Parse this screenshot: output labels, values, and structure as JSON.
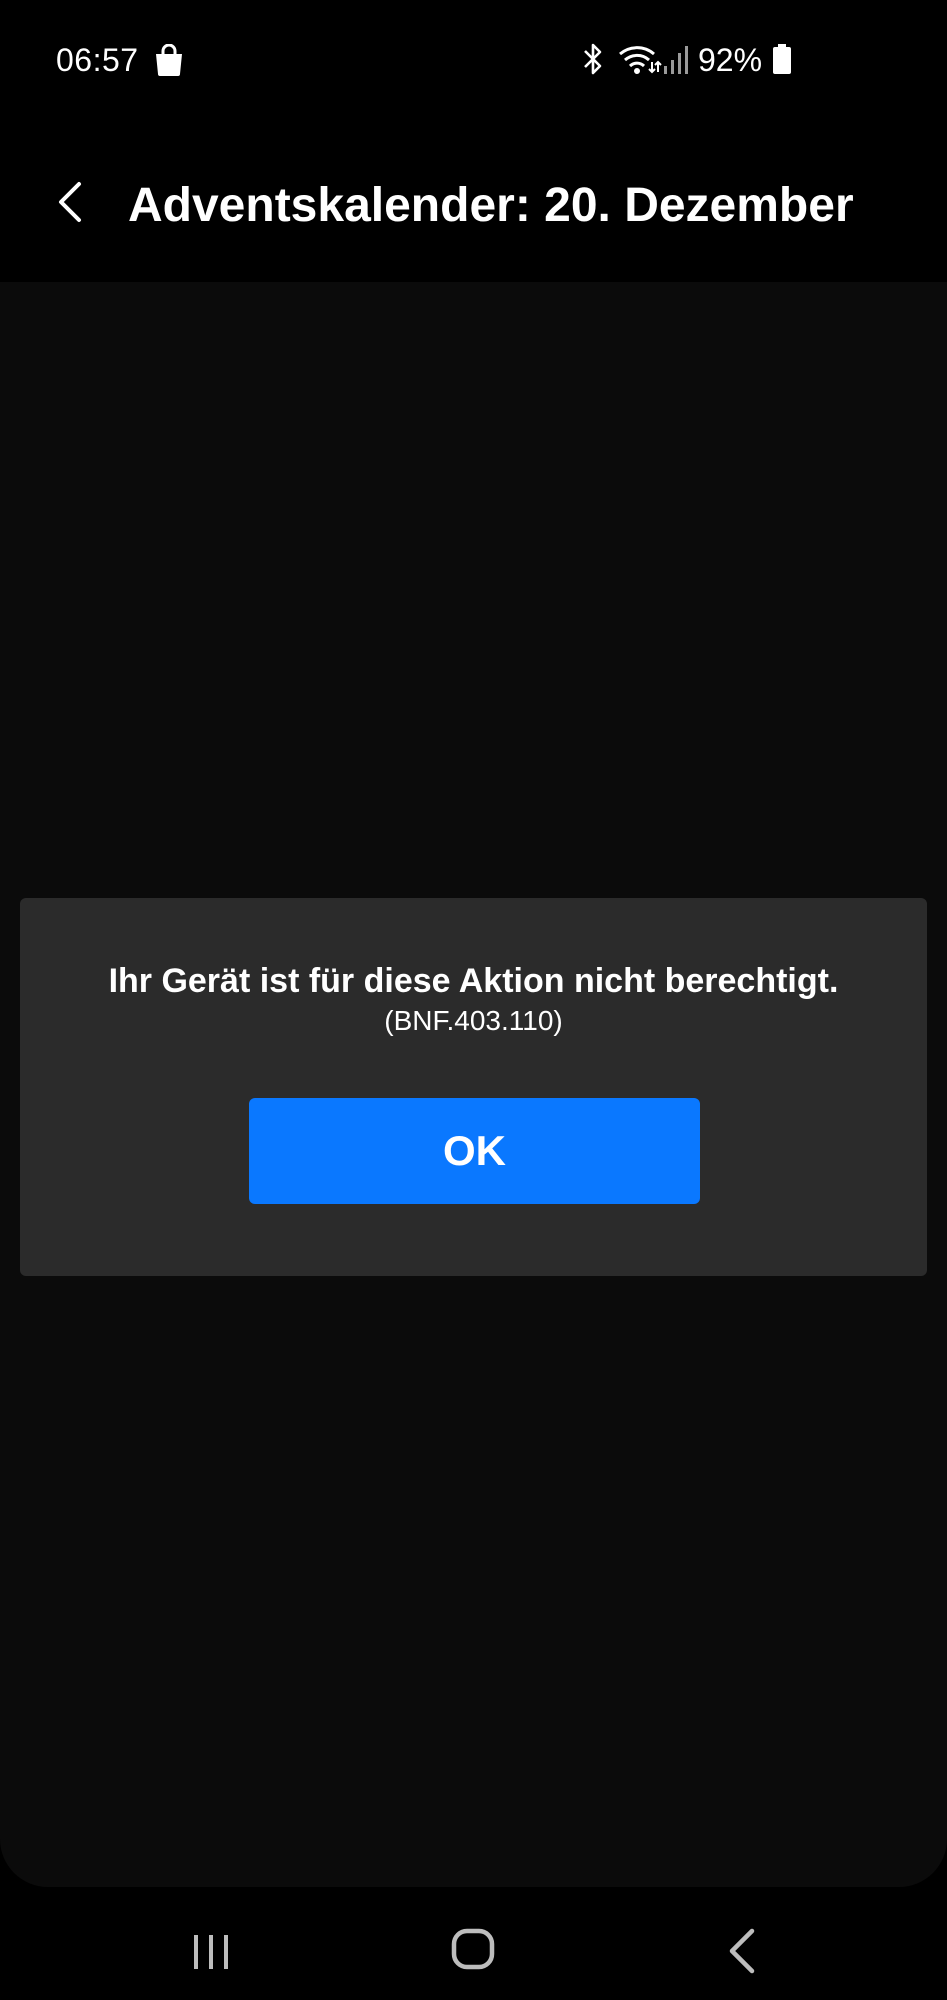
{
  "status_bar": {
    "time": "06:57",
    "battery_percent": "92%",
    "icons": [
      "shopping-bag-icon",
      "bluetooth-icon",
      "wifi-icon",
      "signal-icon",
      "battery-icon"
    ]
  },
  "app_bar": {
    "back_icon": "chevron-left-icon",
    "title": "Adventskalender: 20. Dezember"
  },
  "dialog": {
    "message": "Ihr Gerät ist für diese Aktion nicht berechtigt.",
    "code": "(BNF.403.110)",
    "ok_label": "OK"
  },
  "nav_bar": {
    "icons": [
      "recents-icon",
      "home-icon",
      "back-icon"
    ]
  },
  "colors": {
    "background": "#000000",
    "content_background": "#0b0b0b",
    "dialog_background": "#2b2b2b",
    "accent": "#0a78ff",
    "text": "#ffffff"
  }
}
